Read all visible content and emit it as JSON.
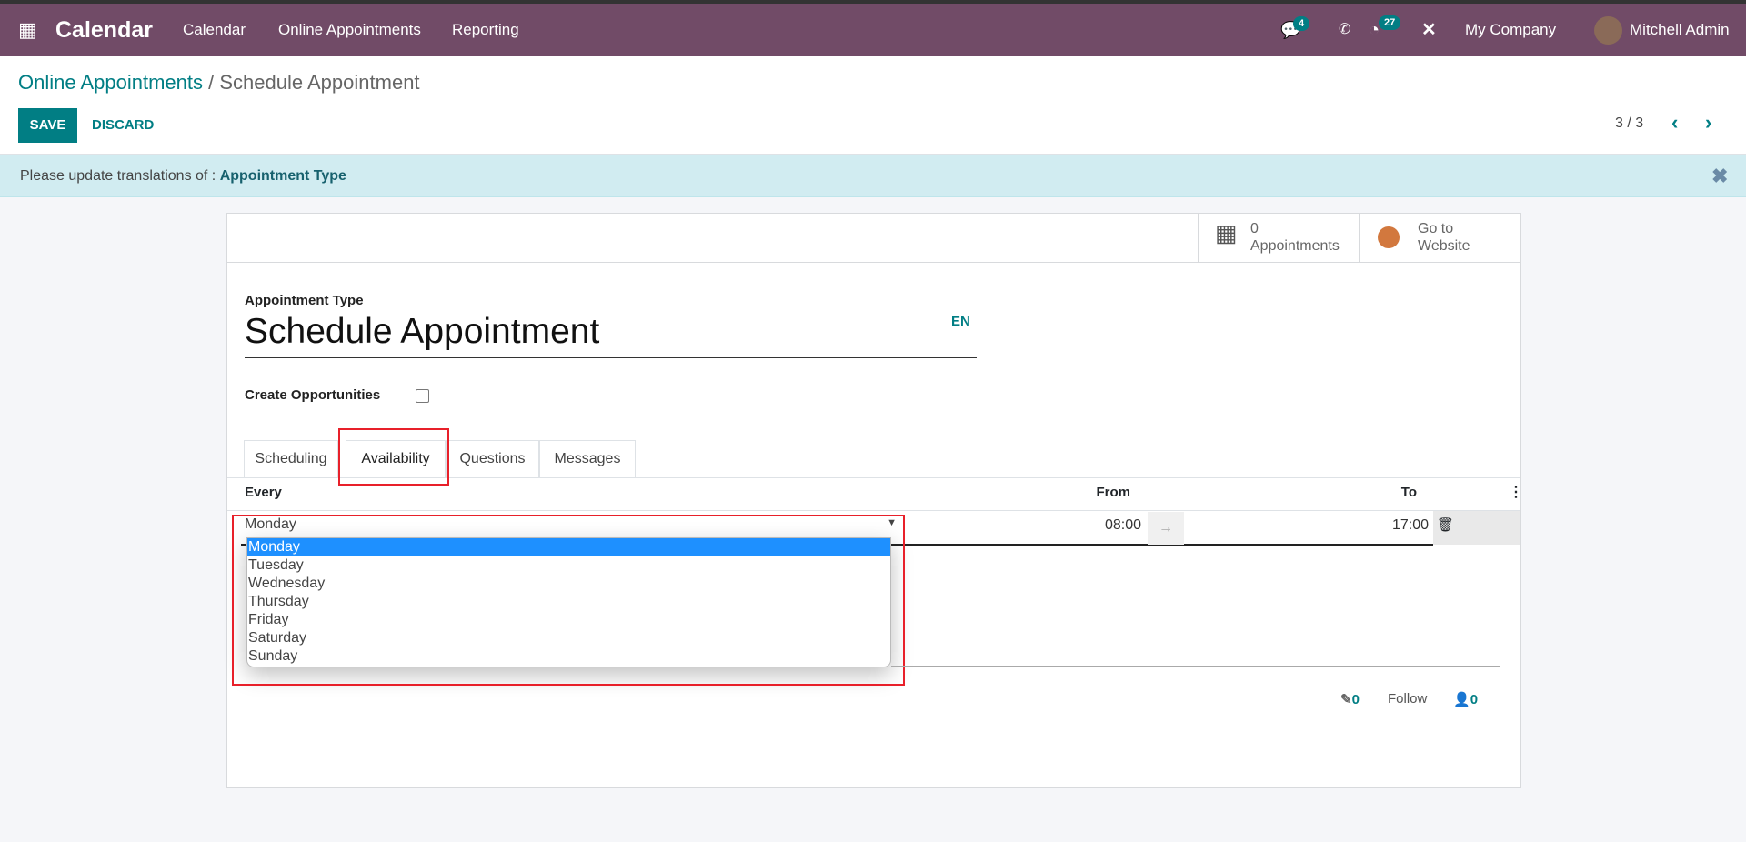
{
  "navbar": {
    "app_title": "Calendar",
    "menu": [
      "Calendar",
      "Online Appointments",
      "Reporting"
    ],
    "messages_badge": "4",
    "activities_badge": "27",
    "company": "My Company",
    "user": "Mitchell Admin"
  },
  "breadcrumb": {
    "parent": "Online Appointments",
    "current": "Schedule Appointment"
  },
  "toolbar": {
    "save": "SAVE",
    "discard": "DISCARD",
    "pager": "3 / 3"
  },
  "alert": {
    "text": "Please update translations of : ",
    "link": "Appointment Type"
  },
  "stat_buttons": {
    "appointments_count": "0",
    "appointments_label": "Appointments",
    "website_line1": "Go to",
    "website_line2": "Website"
  },
  "form": {
    "type_label": "Appointment Type",
    "name": "Schedule Appointment",
    "lang": "EN",
    "create_opps_label": "Create Opportunities",
    "create_opps_checked": false
  },
  "tabs": [
    "Scheduling",
    "Availability",
    "Questions",
    "Messages"
  ],
  "active_tab": "Availability",
  "table": {
    "headers": {
      "every": "Every",
      "from": "From",
      "to": "To"
    },
    "row": {
      "day": "Monday",
      "from": "08:00",
      "to": "17:00"
    }
  },
  "dropdown": {
    "options": [
      "Monday",
      "Tuesday",
      "Wednesday",
      "Thursday",
      "Friday",
      "Saturday",
      "Sunday"
    ],
    "selected": "Monday"
  },
  "chatter": {
    "attachments": "0",
    "follow": "Follow",
    "followers": "0"
  },
  "colors": {
    "brand": "#714b67",
    "accent": "#017e84",
    "highlight": "#e8202a",
    "selected_option": "#1e90ff"
  }
}
